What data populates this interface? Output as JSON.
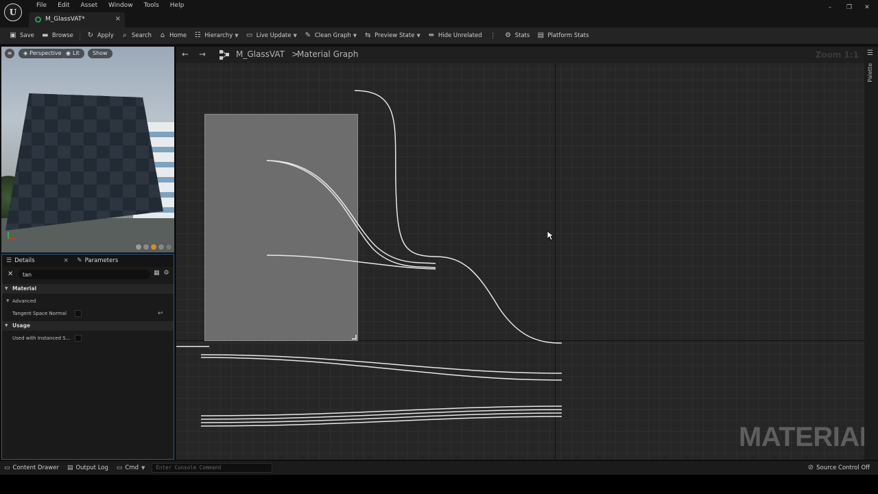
{
  "menu": [
    "File",
    "Edit",
    "Asset",
    "Window",
    "Tools",
    "Help"
  ],
  "document_tab": {
    "label": "M_GlassVAT*"
  },
  "window_controls": {
    "minimize": "–",
    "maximize": "❐",
    "close": "✕"
  },
  "toolbar": {
    "save": "Save",
    "browse": "Browse",
    "apply": "Apply",
    "search": "Search",
    "home": "Home",
    "hierarchy": "Hierarchy",
    "live_update": "Live Update",
    "clean_graph": "Clean Graph",
    "preview_state": "Preview State",
    "hide_unrelated": "Hide Unrelated",
    "stats": "Stats",
    "platform_stats": "Platform Stats"
  },
  "viewport": {
    "perspective": "Perspective",
    "lit": "Lit",
    "show": "Show"
  },
  "details": {
    "tab_details": "Details",
    "tab_parameters": "Parameters",
    "search_value": "tan",
    "section_material": "Material",
    "sub_advanced": "Advanced",
    "prop_tangent": "Tangent Space Normal",
    "section_usage": "Usage",
    "prop_instanced": "Used with Instanced S..."
  },
  "graph": {
    "breadcrumb_material": "M_GlassVAT",
    "breadcrumb_separator": ">",
    "breadcrumb_graph": "Material Graph",
    "zoom": "Zoom 1:1",
    "watermark": "MATERIAL"
  },
  "palette": {
    "label": "Palette"
  },
  "statusbar": {
    "content_drawer": "Content Drawer",
    "output_log": "Output Log",
    "cmd": "Cmd",
    "console_placeholder": "Enter Console Command",
    "source_control": "Source Control Off"
  },
  "colors": {
    "accent_blue": "#2c5b8f",
    "tab_dot_green": "#2e9b55",
    "wire": "#e8e8e8"
  }
}
